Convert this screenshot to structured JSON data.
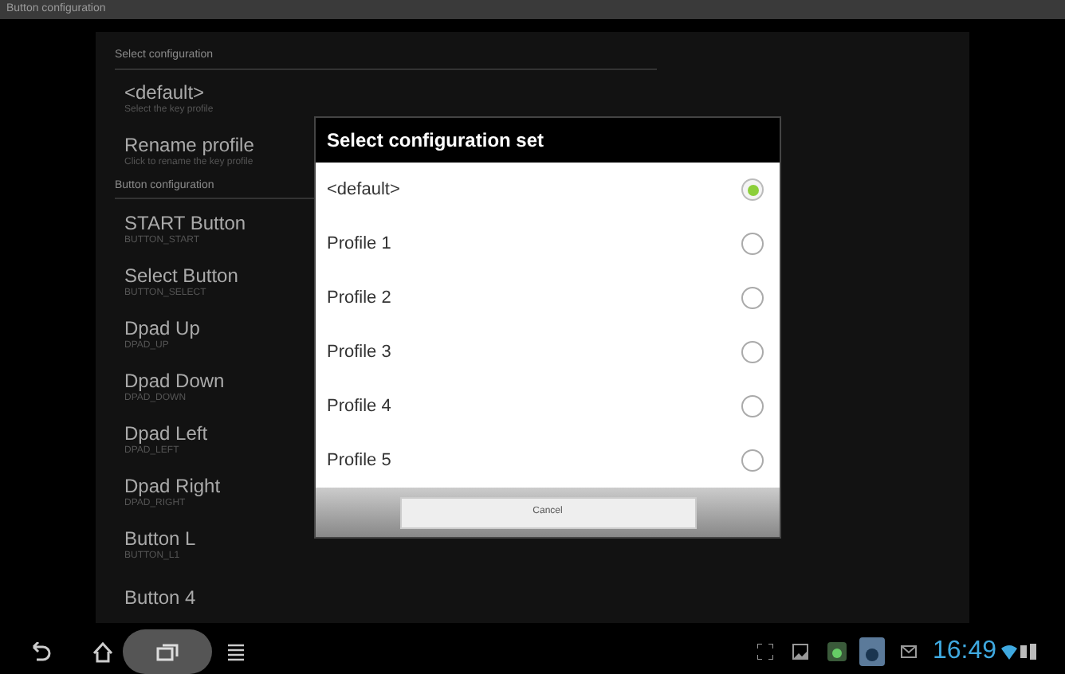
{
  "window": {
    "title": "Button configuration"
  },
  "sections": [
    {
      "header": "Select configuration",
      "items": [
        {
          "title": "<default>",
          "summary": "Select the key profile"
        },
        {
          "title": "Rename profile",
          "summary": "Click to rename the key profile"
        }
      ]
    },
    {
      "header": "Button configuration",
      "items": [
        {
          "title": "START Button",
          "summary": "BUTTON_START"
        },
        {
          "title": "Select Button",
          "summary": "BUTTON_SELECT"
        },
        {
          "title": "Dpad Up",
          "summary": "DPAD_UP"
        },
        {
          "title": "Dpad Down",
          "summary": "DPAD_DOWN"
        },
        {
          "title": "Dpad Left",
          "summary": "DPAD_LEFT"
        },
        {
          "title": "Dpad Right",
          "summary": "DPAD_RIGHT"
        },
        {
          "title": "Button L",
          "summary": "BUTTON_L1"
        },
        {
          "title": "Button 4"
        }
      ]
    }
  ],
  "dialog": {
    "title": "Select configuration set",
    "options": [
      {
        "label": "<default>",
        "selected": true
      },
      {
        "label": "Profile 1",
        "selected": false
      },
      {
        "label": "Profile 2",
        "selected": false
      },
      {
        "label": "Profile 3",
        "selected": false
      },
      {
        "label": "Profile 4",
        "selected": false
      },
      {
        "label": "Profile 5",
        "selected": false
      }
    ],
    "cancel": "Cancel"
  },
  "status_bar": {
    "time": "16:49"
  }
}
